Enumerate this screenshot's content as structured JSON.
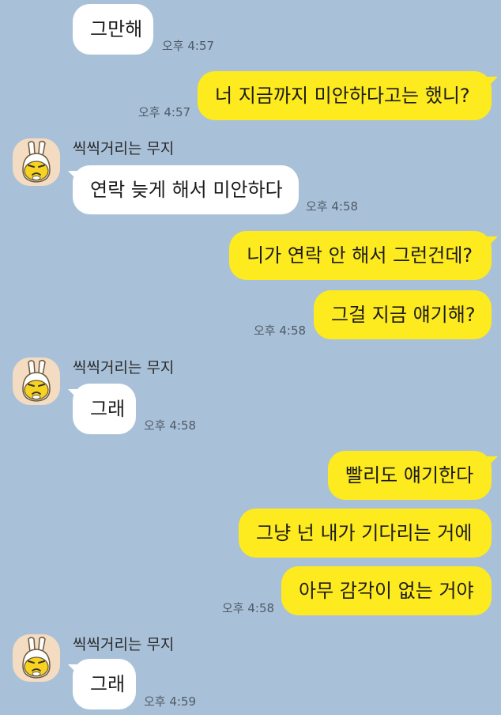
{
  "colors": {
    "background": "#a9c1d8",
    "incoming_bubble": "#ffffff",
    "outgoing_bubble": "#fdea1f"
  },
  "avatar_icon": "kakao-friends-muzi-icon",
  "messages": [
    {
      "direction": "in",
      "text": "그만해",
      "time": "오후 4:57"
    },
    {
      "direction": "out",
      "text": "너 지금까지 미안하다고는 했니?",
      "time": "오후 4:57"
    },
    {
      "direction": "in",
      "sender": "씩씩거리는 무지",
      "text": "연락 늦게 해서 미안하다",
      "time": "오후 4:58"
    },
    {
      "direction": "out",
      "text": "니가 연락 안 해서 그런건데?"
    },
    {
      "direction": "out",
      "text": "그걸 지금 얘기해?",
      "time": "오후 4:58"
    },
    {
      "direction": "in",
      "sender": "씩씩거리는 무지",
      "text": "그래",
      "time": "오후 4:58"
    },
    {
      "direction": "out",
      "text": "빨리도 얘기한다"
    },
    {
      "direction": "out",
      "text": "그냥 넌 내가 기다리는 거에"
    },
    {
      "direction": "out",
      "text": "아무 감각이 없는 거야",
      "time": "오후 4:58"
    },
    {
      "direction": "in",
      "sender": "씩씩거리는 무지",
      "text": "그래",
      "time": "오후 4:59"
    }
  ]
}
